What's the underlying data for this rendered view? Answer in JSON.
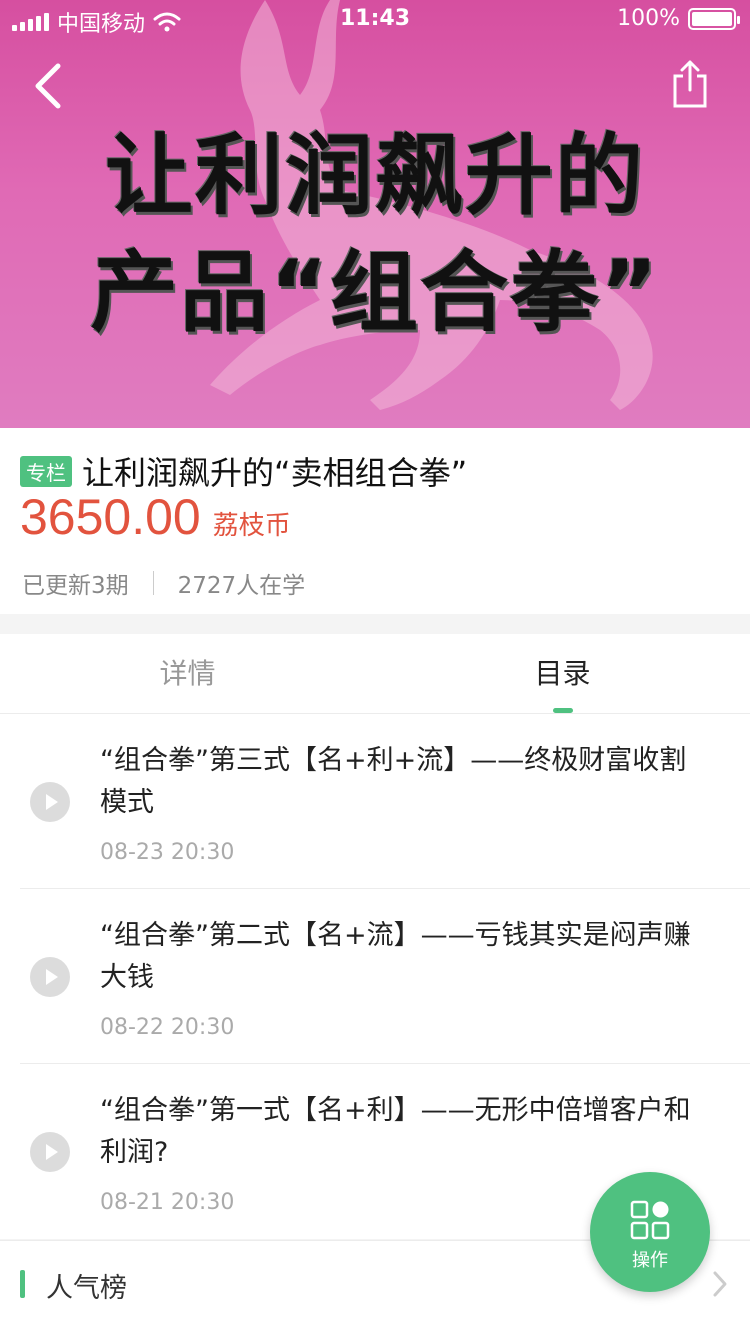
{
  "status_bar": {
    "carrier": "中国移动",
    "time": "11:43",
    "battery": "100%"
  },
  "hero": {
    "line1": "让利润飙升的",
    "line2": "产品“组合拳”"
  },
  "course": {
    "tag": "专栏",
    "title": "让利润飙升的“卖相组合拳”",
    "price": "3650.00",
    "unit": "荔枝币",
    "updated": "已更新3期",
    "learners": "2727人在学"
  },
  "tabs": [
    {
      "label": "详情",
      "active": false
    },
    {
      "label": "目录",
      "active": true
    }
  ],
  "episodes": [
    {
      "title": "“组合拳”第三式【名+利+流】——终极财富收割模式",
      "date": "08-23 20:30"
    },
    {
      "title": "“组合拳”第二式【名+流】——亏钱其实是闷声赚大钱",
      "date": "08-22 20:30"
    },
    {
      "title": "“组合拳”第一式【名+利】——无形中倍增客户和利润?",
      "date": "08-21 20:30"
    }
  ],
  "popular": {
    "label": "人气榜"
  },
  "fab": {
    "label": "操作"
  },
  "colors": {
    "accent": "#4fc180",
    "price": "#e2533e",
    "hero": "#d64fa0"
  },
  "icons": [
    "back-icon",
    "share-icon",
    "play-icon",
    "operation-grid-icon",
    "chevron-right-icon"
  ]
}
